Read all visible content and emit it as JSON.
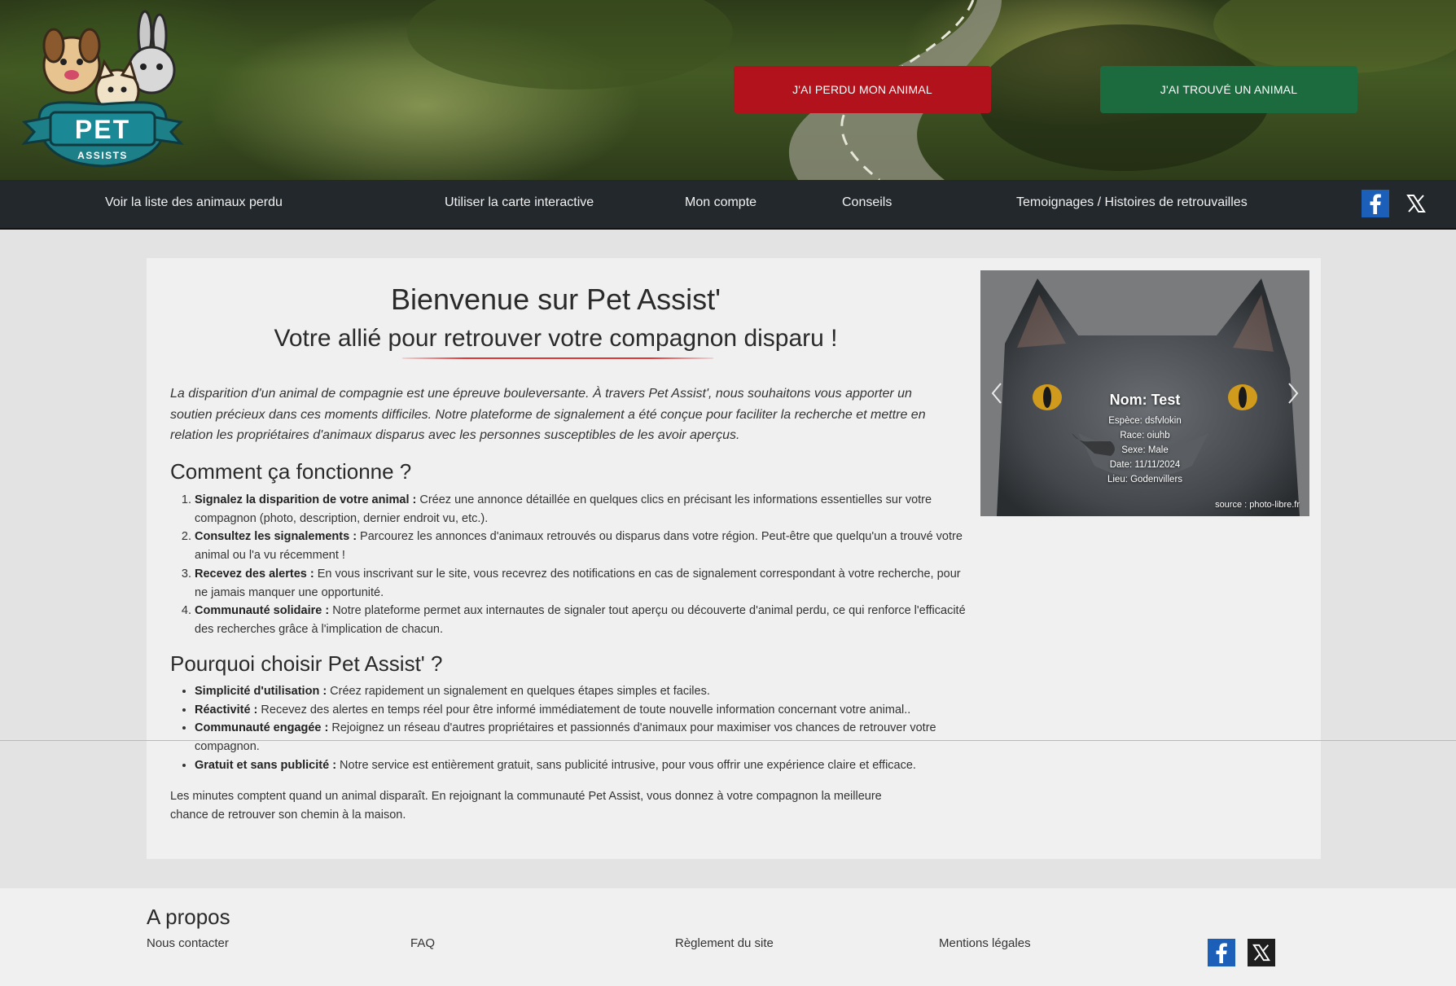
{
  "header": {
    "logo_text": "PET",
    "logo_subtext": "ASSISTS",
    "lost_button": "J'AI PERDU MON ANIMAL",
    "found_button": "J'AI TROUVÉ UN ANIMAL"
  },
  "nav": {
    "items": [
      {
        "label": "Voir la liste des animaux perdu"
      },
      {
        "label": "Utiliser la carte interactive"
      },
      {
        "label": "Mon compte"
      },
      {
        "label": "Conseils"
      },
      {
        "label": "Temoignages / Histoires de retrouvailles"
      }
    ],
    "social": [
      "facebook-icon",
      "x-icon"
    ]
  },
  "main": {
    "title": "Bienvenue sur Pet Assist'",
    "subtitle": "Votre allié pour retrouver votre compagnon disparu !",
    "intro": "La disparition d'un animal de compagnie est une épreuve bouleversante. À travers Pet Assist', nous souhaitons vous apporter un soutien précieux dans ces moments difficiles. Notre plateforme de signalement a été conçue pour faciliter la recherche et mettre en relation les propriétaires d'animaux disparus avec les personnes susceptibles de les avoir aperçus.",
    "how_title": "Comment ça fonctionne ?",
    "how_steps": [
      {
        "strong": "Signalez la disparition de votre animal :",
        "text": " Créez une annonce détaillée en quelques clics en précisant les informations essentielles sur votre compagnon (photo, description, dernier endroit vu, etc.)."
      },
      {
        "strong": "Consultez les signalements :",
        "text": " Parcourez les annonces d'animaux retrouvés ou disparus dans votre région. Peut-être que quelqu'un a trouvé votre animal ou l'a vu récemment !"
      },
      {
        "strong": "Recevez des alertes :",
        "text": " En vous inscrivant sur le site, vous recevrez des notifications en cas de signalement correspondant à votre recherche, pour ne jamais manquer une opportunité."
      },
      {
        "strong": "Communauté solidaire :",
        "text": " Notre plateforme permet aux internautes de signaler tout aperçu ou découverte d'animal perdu, ce qui renforce l'efficacité des recherches grâce à l'implication de chacun."
      }
    ],
    "why_title": "Pourquoi choisir Pet Assist' ?",
    "why_points": [
      {
        "strong": "Simplicité d'utilisation :",
        "text": " Créez rapidement un signalement en quelques étapes simples et faciles."
      },
      {
        "strong": "Réactivité :",
        "text": " Recevez des alertes en temps réel pour être informé immédiatement de toute nouvelle information concernant votre animal.."
      },
      {
        "strong": "Communauté engagée :",
        "text": " Rejoignez un réseau d'autres propriétaires et passionnés d'animaux pour maximiser vos chances de retrouver votre compagnon."
      },
      {
        "strong": "Gratuit et sans publicité :",
        "text": " Notre service est entièrement gratuit, sans publicité intrusive, pour vous offrir une expérience claire et efficace."
      }
    ],
    "outro": "Les minutes comptent quand un animal disparaît. En rejoignant la communauté Pet Assist, vous donnez à votre compagnon la meilleure chance de retrouver son chemin à la maison."
  },
  "carousel": {
    "name": "Nom: Test",
    "species": "Espèce: dsfvlokin",
    "race": "Race: oiuhb",
    "sex": "Sexe: Male",
    "date": "Date: 11/11/2024",
    "place": "Lieu: Godenvillers",
    "source": "source : photo-libre.fr"
  },
  "footer": {
    "title": "A propos",
    "links": [
      "Nous contacter",
      "FAQ",
      "Règlement du site",
      "Mentions légales"
    ]
  },
  "colors": {
    "lost": "#b2121b",
    "found": "#1c6b3f",
    "nav_bg": "#23282d",
    "facebook": "#1877f2"
  }
}
